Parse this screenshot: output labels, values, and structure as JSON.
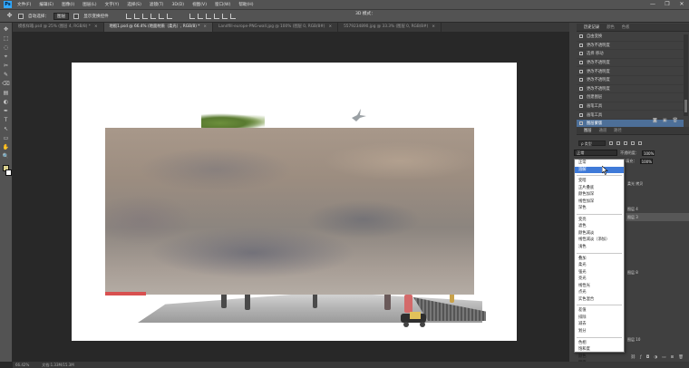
{
  "menubar": {
    "logo": "Ps",
    "items": [
      "文件(F)",
      "编辑(E)",
      "图像(I)",
      "图层(L)",
      "文字(Y)",
      "选择(S)",
      "滤镜(T)",
      "3D(D)",
      "视图(V)",
      "窗口(W)",
      "帮助(H)"
    ],
    "window_controls": [
      "—",
      "❐",
      "✕"
    ]
  },
  "options": {
    "auto_select_label": "自动选择：",
    "auto_select_value": "图层",
    "show_transform_label": "显示变换控件",
    "mode_3d_label": "3D 模式："
  },
  "tabs": [
    {
      "label": "模板样箱.psd @ 25% (图层 4, RGB/8) *",
      "active": false
    },
    {
      "label": "地板1.psd @ 66.4% (地面材质（柔光）, RGB/8) *",
      "active": true
    },
    {
      "label": "Landfill-europe-PNG-wall.jpg @ 100% (图层 0, RGB/8#)",
      "active": false
    },
    {
      "label": "5579234890.jpg @ 33.3% (图层 0, RGB/8#)",
      "active": false
    }
  ],
  "tools": [
    "✥",
    "⬚",
    "◌",
    "⌖",
    "✂",
    "✎",
    "⌫",
    "▤",
    "◐",
    "✒",
    "T",
    "↖",
    "▭",
    "✋",
    "🔍"
  ],
  "history": {
    "tabs": [
      "历史记录",
      "颜色",
      "色板"
    ],
    "items": [
      {
        "label": "自由变换",
        "sel": false
      },
      {
        "label": "更改不透明度",
        "sel": false
      },
      {
        "label": "选择 移动",
        "sel": false
      },
      {
        "label": "更改不透明度",
        "sel": false
      },
      {
        "label": "更改不透明度",
        "sel": false
      },
      {
        "label": "更改不透明度",
        "sel": false
      },
      {
        "label": "更改不透明度",
        "sel": false
      },
      {
        "label": "创建图层",
        "sel": false
      },
      {
        "label": "画笔工具",
        "sel": false
      },
      {
        "label": "画笔工具",
        "sel": false
      },
      {
        "label": "图层蒙版",
        "sel": true
      }
    ]
  },
  "layers": {
    "tabs": [
      "图层",
      "通道",
      "路径"
    ],
    "kind_label": "ρ 类型",
    "blend_value": "正常",
    "opacity_label": "不透明度：",
    "opacity_value": "100%",
    "fill_label": "填充：",
    "fill_value": "100%",
    "visible_rows": [
      "柔光 拷贝",
      "图层 4",
      "图层 3",
      "图层 8",
      "图层 10"
    ]
  },
  "blend_modes": {
    "groups": [
      [
        "正常",
        "溶解"
      ],
      [
        "变暗",
        "正片叠底",
        "颜色加深",
        "线性加深",
        "深色"
      ],
      [
        "变亮",
        "滤色",
        "颜色减淡",
        "线性减淡（添加）",
        "浅色"
      ],
      [
        "叠加",
        "柔光",
        "强光",
        "亮光",
        "线性光",
        "点光",
        "实色混合"
      ],
      [
        "差值",
        "排除",
        "减去",
        "划分"
      ],
      [
        "色相",
        "饱和度",
        "颜色",
        "明度"
      ]
    ],
    "highlighted": "溶解"
  },
  "status": {
    "zoom": "66.42%",
    "doc_info": "文档:1.33M/15.3M"
  },
  "colors": {
    "foreground": "#d9cf8e",
    "background": "#ffffff",
    "accent": "#3f7ad8"
  }
}
